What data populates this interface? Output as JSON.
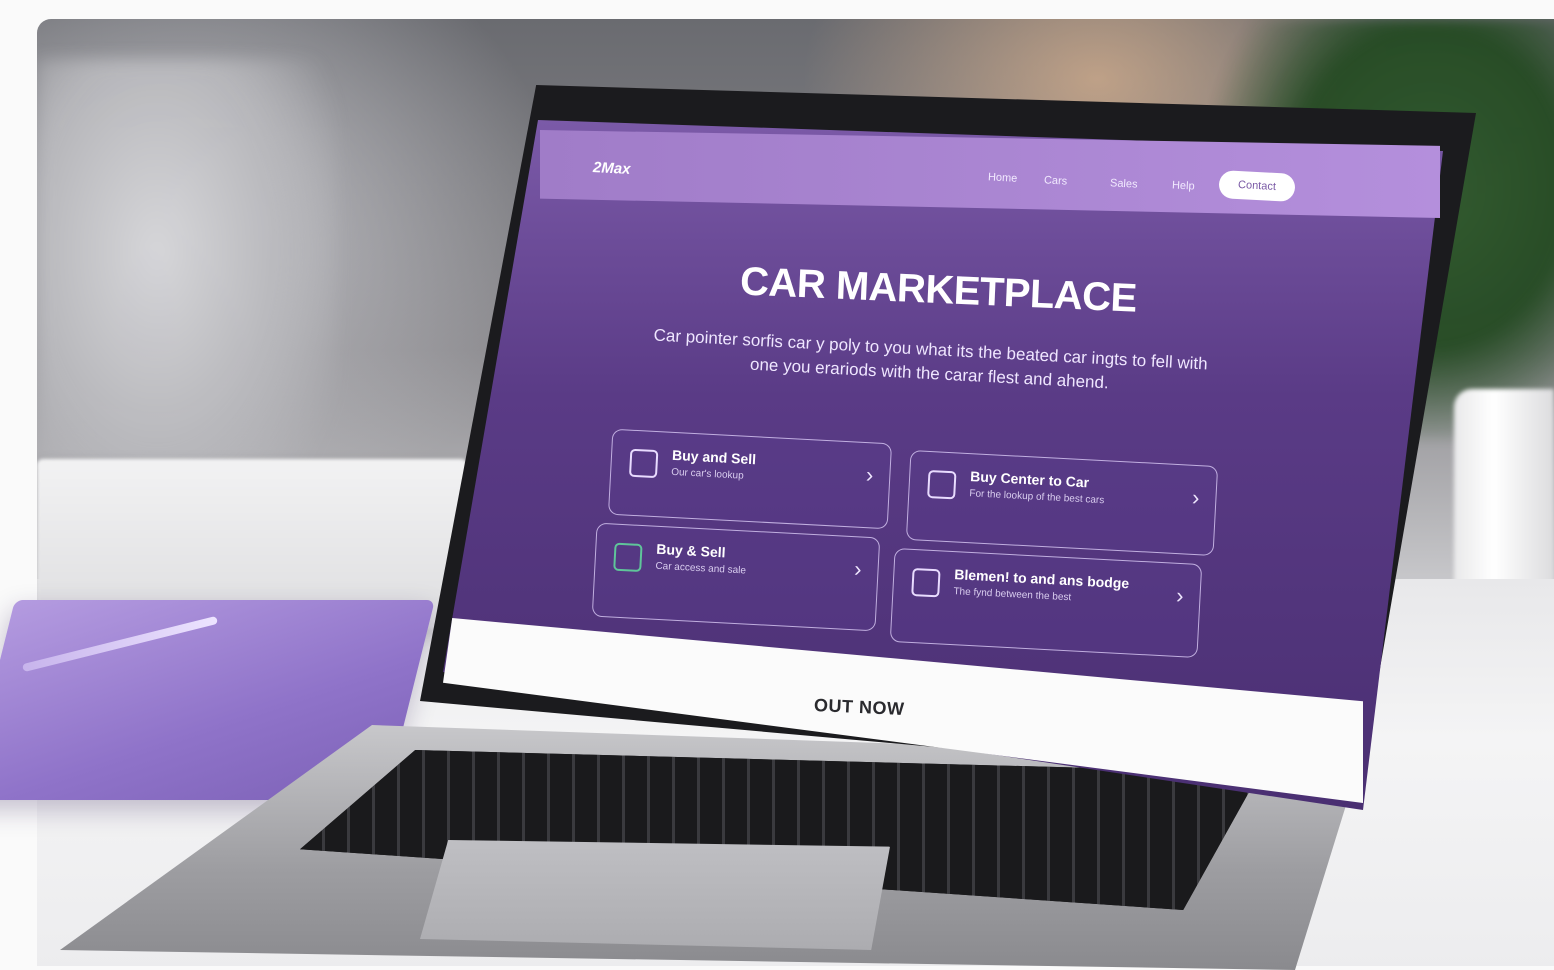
{
  "site": {
    "logo": "2Max",
    "nav_links": [
      "Home",
      "Cars",
      "Sales",
      "Help"
    ],
    "nav_cta": "Contact"
  },
  "hero": {
    "title": "CAR MARKETPLACE",
    "subtitle": "Car pointer sorfis car y poly to you what its the beated car ingts to fell with one you erariods with the carar flest and ahend."
  },
  "cards": [
    {
      "title": "Buy and Sell",
      "desc": "Our car's lookup",
      "icon": "home-car-icon"
    },
    {
      "title": "Buy Center to Car",
      "desc": "For the lookup of the best cars",
      "icon": "car-icon"
    },
    {
      "title": "Buy & Sell",
      "desc": "Car access and sale",
      "icon": "document-icon"
    },
    {
      "title": "Blemen! to and ans bodge",
      "desc": "The fynd between the best",
      "icon": "car-lock-icon"
    }
  ],
  "banner": {
    "label": "OUT NOW"
  },
  "colors": {
    "primary": "#5a3b86",
    "nav": "#b48fdc",
    "accent_green": "#5fc59a",
    "notebook": "#8f73c9"
  }
}
